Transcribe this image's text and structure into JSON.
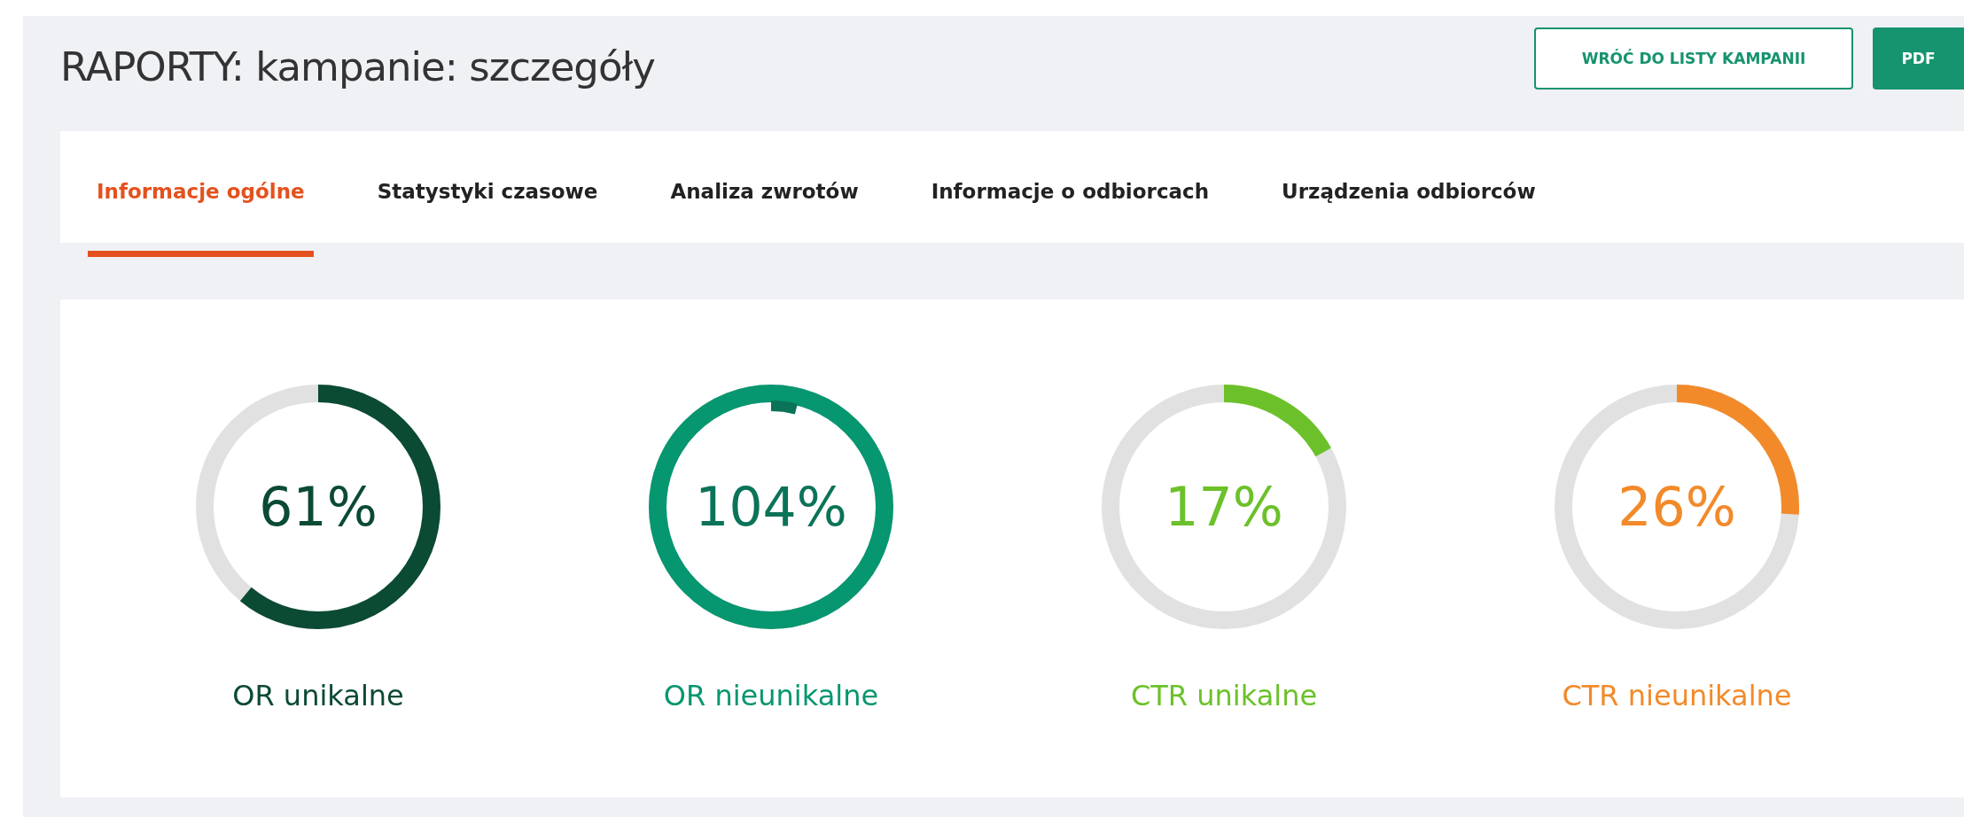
{
  "header": {
    "title": "RAPORTY: kampanie: szczegóły",
    "buttons": [
      {
        "label": "WRÓĆ DO LISTY KAMPANII",
        "kind": "outline"
      },
      {
        "label": "PDF",
        "kind": "solid"
      }
    ]
  },
  "tabs": [
    {
      "label": "Informacje ogólne",
      "selected": true
    },
    {
      "label": "Statystyki czasowe",
      "selected": false
    },
    {
      "label": "Analiza zwrotów",
      "selected": false
    },
    {
      "label": "Informacje o odbiorcach",
      "selected": false
    },
    {
      "label": "Urządzenia odbiorców",
      "selected": false
    }
  ],
  "metrics": [
    {
      "value": "61%",
      "label": "OR unikalne",
      "level": 0.61,
      "color": "#0b4a33"
    },
    {
      "value": "104%",
      "label": "OR nieunikalne",
      "level": 1,
      "color": "#069670",
      "overflow": {
        "level": 0.04,
        "color": "#0b7358"
      }
    },
    {
      "value": "17%",
      "label": "CTR unikalne",
      "level": 0.17,
      "color": "#6cc12a"
    },
    {
      "value": "26%",
      "label": "CTR nieunikalne",
      "level": 0.26,
      "color": "#f28a2a"
    }
  ]
}
